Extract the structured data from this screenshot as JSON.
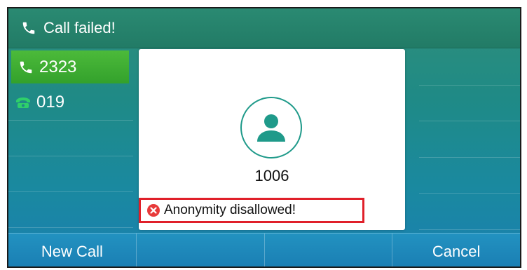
{
  "titlebar": {
    "icon": "phone-handset-icon",
    "title": "Call failed!"
  },
  "lines": [
    {
      "label": "2323",
      "icon": "phone-handset-icon",
      "active": true
    },
    {
      "label": "019",
      "icon": "line-key-phone-icon",
      "active": false
    }
  ],
  "card": {
    "avatar_icon": "contact-avatar-icon",
    "number": "1006",
    "error_icon": "error-x-icon",
    "error_text": "Anonymity disallowed!"
  },
  "softkeys": [
    "New Call",
    "",
    "",
    "Cancel"
  ],
  "colors": {
    "titlebar": "#227b66",
    "active_line": "#33a12c",
    "softkey_bar": "#1a7db3",
    "error_border": "#e0202a",
    "accent": "#1f9a8a"
  }
}
